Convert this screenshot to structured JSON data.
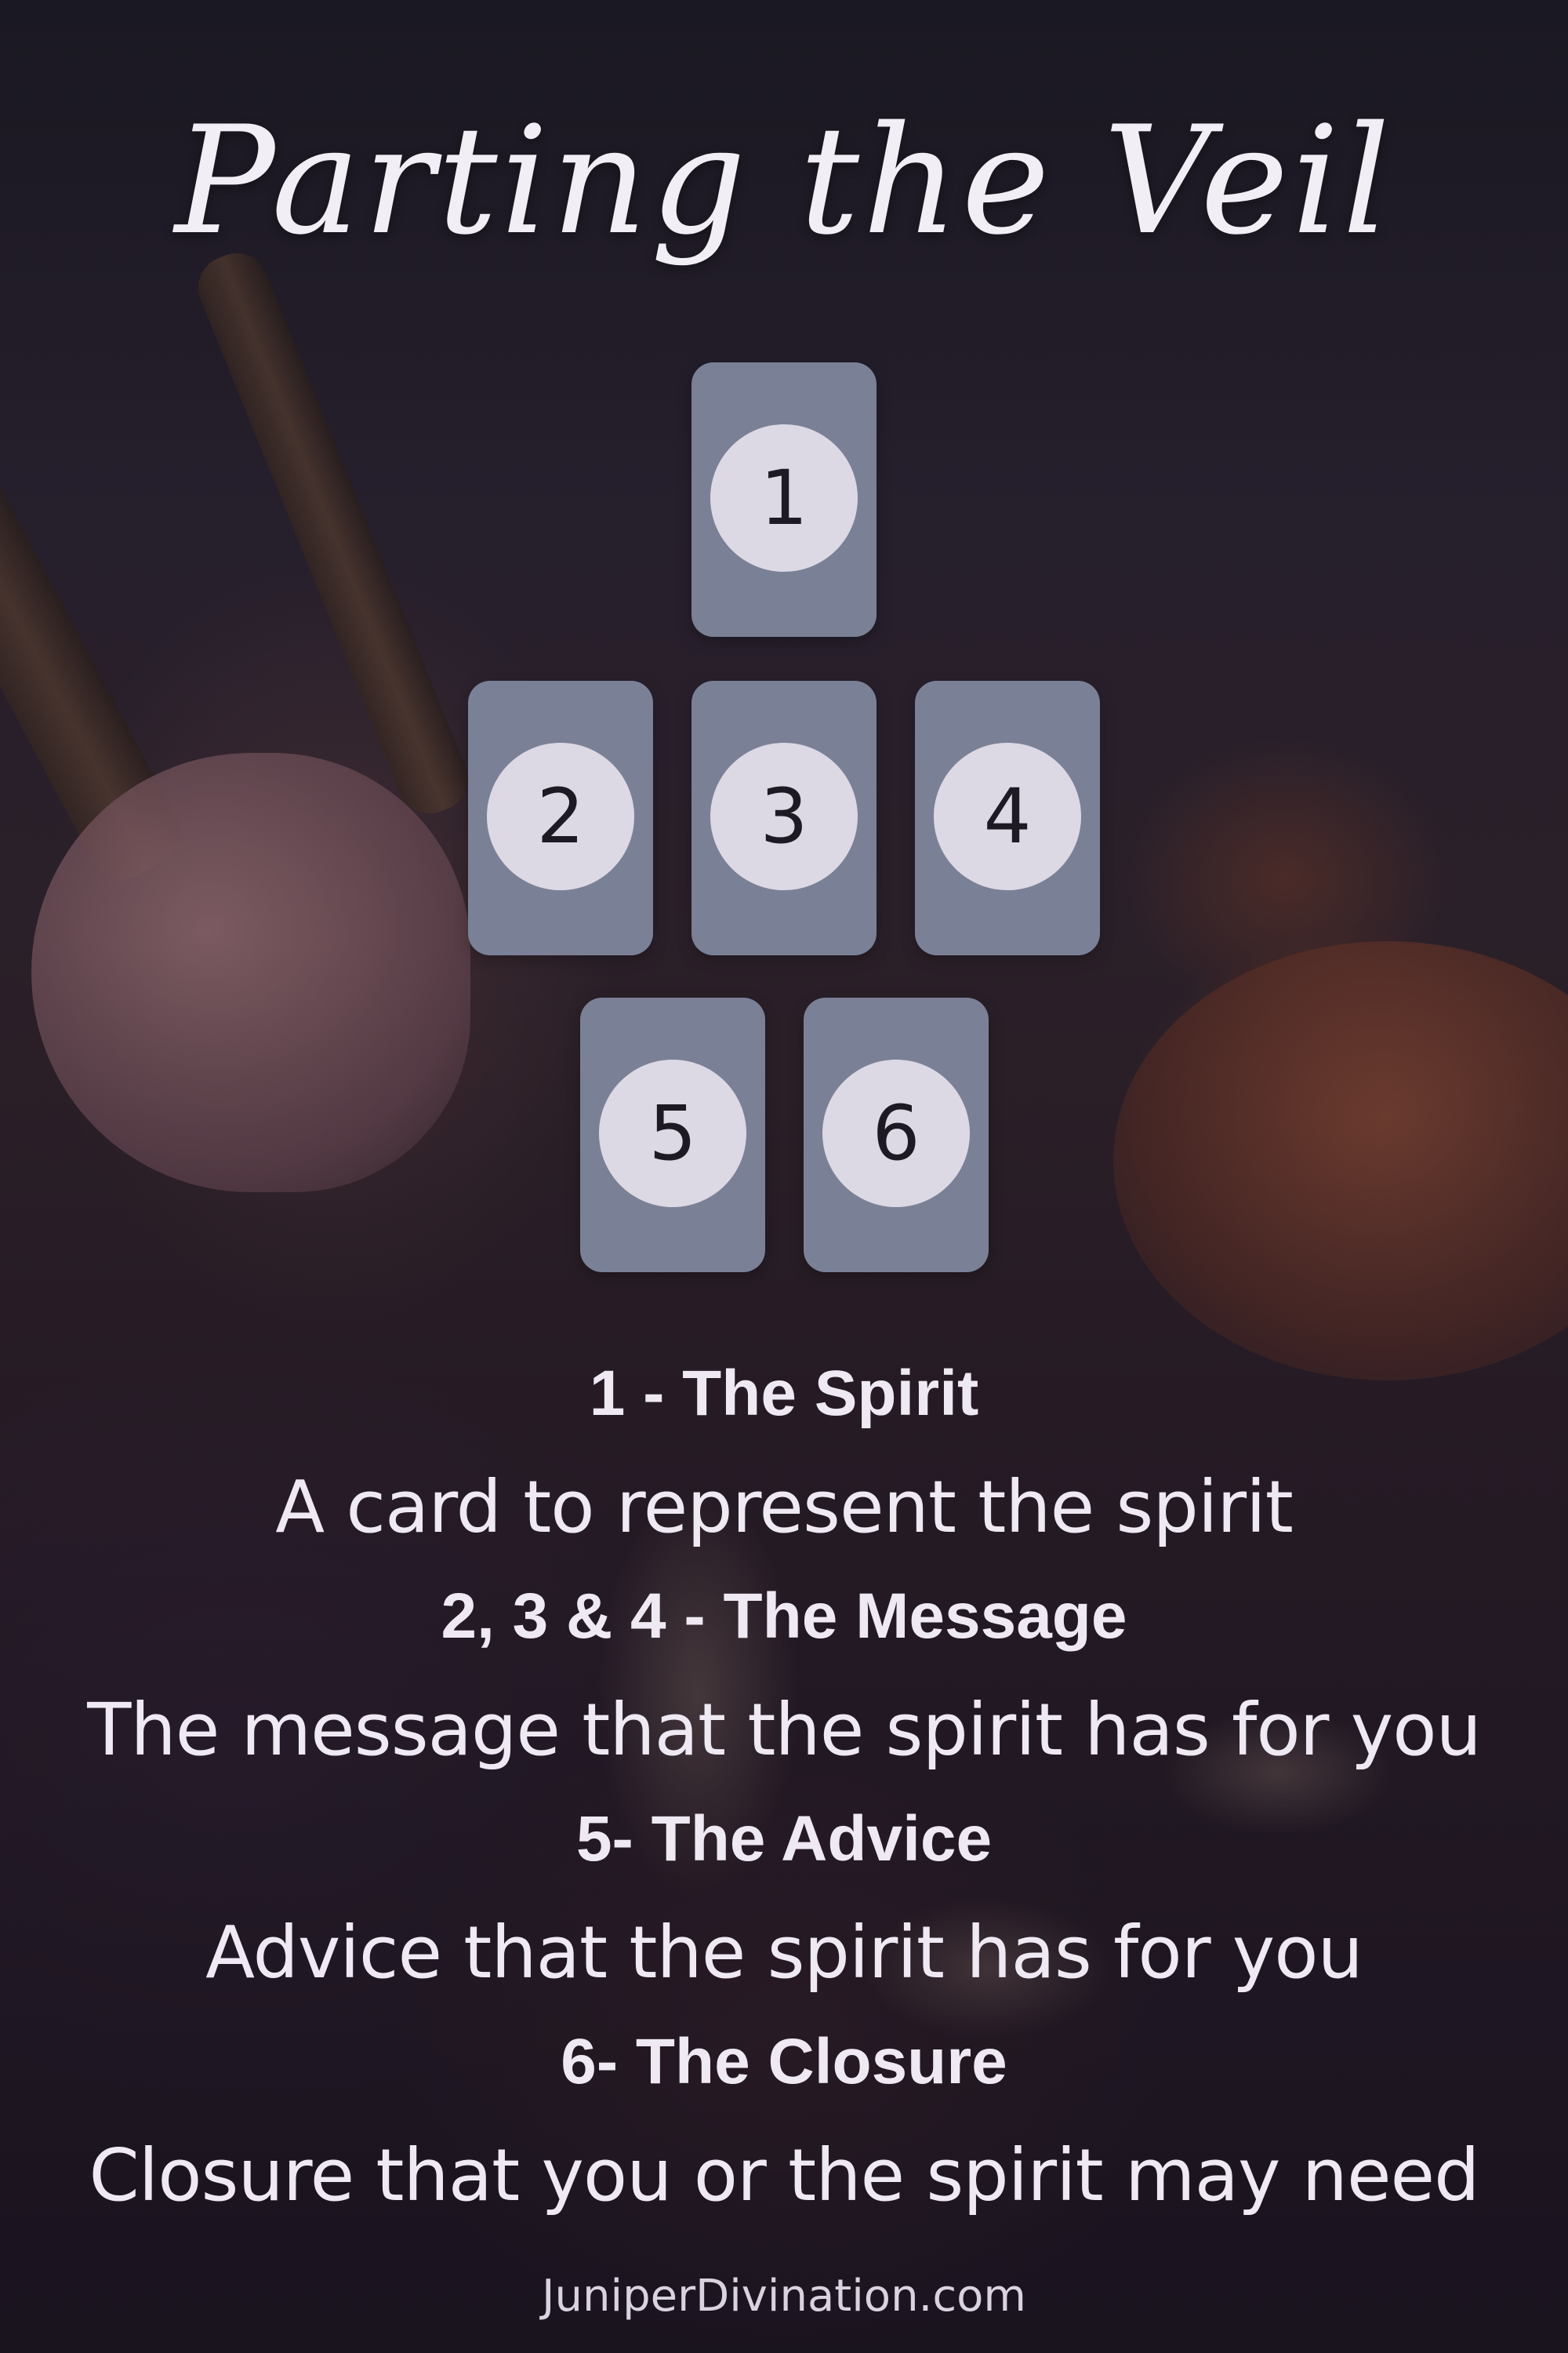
{
  "title": "Parting the Veil",
  "cards": [
    {
      "number": "1"
    },
    {
      "number": "2"
    },
    {
      "number": "3"
    },
    {
      "number": "4"
    },
    {
      "number": "5"
    },
    {
      "number": "6"
    }
  ],
  "positions": [
    {
      "heading": "1 - The Spirit",
      "description": "A card to represent the spirit"
    },
    {
      "heading": "2, 3 & 4 - The Message",
      "description": "The message that the spirit has for you"
    },
    {
      "heading": "5- The Advice",
      "description": "Advice that the spirit has for you"
    },
    {
      "heading": "6- The Closure",
      "description": "Closure that you or the spirit may need"
    }
  ],
  "footer": "JuniperDivination.com",
  "colors": {
    "card": "#7a8096",
    "circle": "#dcd8e4",
    "text": "#eee9f3"
  }
}
